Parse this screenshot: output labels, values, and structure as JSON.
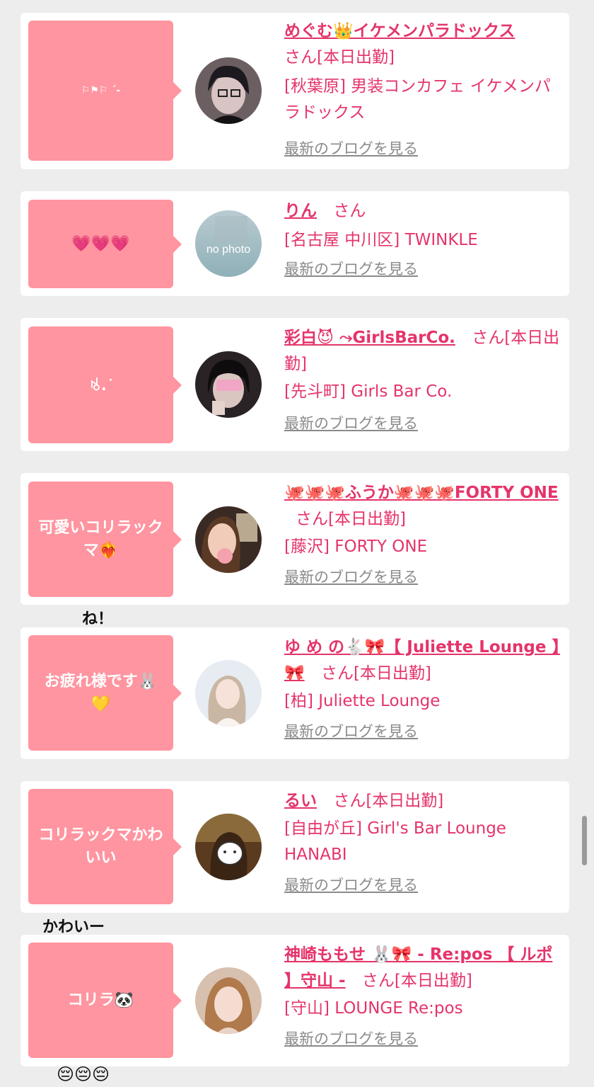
{
  "cards": [
    {
      "bubble": "⚐⚑⚐ ˊ-",
      "name": "めぐむ👑イケメンパラドックス",
      "suffix": "さん[本日出勤]",
      "shop": "[秋葉原] 男装コンカフェ イケメンパラドックス",
      "blog": "最新のブログを見る"
    },
    {
      "bubble": "💗💗💗",
      "name": "りん",
      "suffix": "さん",
      "shop": "[名古屋 中川区] TWINKLE",
      "blog": "最新のブログを見る",
      "avatar_text": "no photo"
    },
    {
      "bubble": "ꂚ. ͘",
      "name": "彩白😈 ⤳GirlsBarCo.",
      "suffix": "さん[本日出勤]",
      "shop": "[先斗町] Girls Bar Co.",
      "blog": "最新のブログを見る"
    },
    {
      "bubble": "可愛いコリラックマ❤️‍🔥",
      "name": "🐙🐙🐙ふうか🐙🐙🐙FORTY ONE",
      "suffix": "さん[本日出勤]",
      "shop": "[藤沢] FORTY ONE",
      "blog": "最新のブログを見る"
    },
    {
      "bubble": "お疲れ様です🐰💛",
      "name": "ゆ め の🐇🎀【 Juliette Lounge 】🎀",
      "suffix": "さん[本日出勤]",
      "shop": "[柏] Juliette Lounge",
      "blog": "最新のブログを見る"
    },
    {
      "bubble": "コリラックマかわいい",
      "name": "るい",
      "suffix": "さん[本日出勤]",
      "shop": "[自由が丘] Girl's Bar Lounge HANABI",
      "blog": "最新のブログを見る"
    },
    {
      "bubble": "コリラ🐼",
      "name": "神崎ももせ 🐰🎀 - Re:pos 【 ルポ 】守山 -",
      "suffix": "さん[本日出勤]",
      "shop": "[守山] LOUNGE Re:pos",
      "blog": "最新のブログを見る"
    }
  ],
  "overlays": {
    "ne": "ね！",
    "kawaii": "かわいー",
    "faces": "😔😔😔"
  },
  "colors": {
    "bubble": "#ff95a0",
    "accent": "#e5346a",
    "link_gray": "#8a8a8a",
    "background": "#ededed"
  }
}
